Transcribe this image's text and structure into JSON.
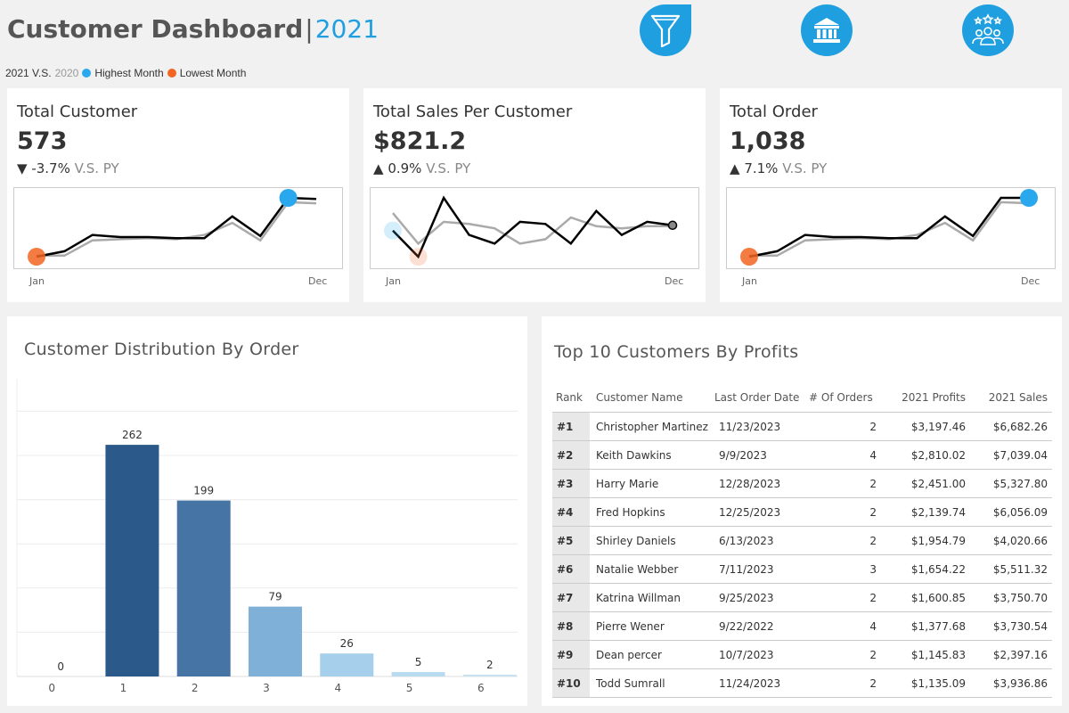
{
  "header": {
    "title": "Customer Dashboard",
    "separator": "|",
    "year": "2021"
  },
  "legend": {
    "current": "2021 V.S.",
    "previous": "2020",
    "highest_label": "Highest Month",
    "lowest_label": "Lowest Month"
  },
  "colors": {
    "accent": "#1f9fe0",
    "highest": "#29a8ee",
    "lowest": "#f26522",
    "line_current": "#000000",
    "line_previous": "#aaaaaa"
  },
  "nav": [
    {
      "icon": "filter-icon"
    },
    {
      "icon": "bank-icon"
    },
    {
      "icon": "customers-icon"
    }
  ],
  "kpis": [
    {
      "label": "Total Customer",
      "value": "573",
      "arrow": "▼",
      "delta": "-3.7%",
      "vs": "V.S. PY",
      "x_start": "Jan",
      "x_end": "Dec",
      "current": [
        43,
        48,
        63,
        61,
        61,
        60,
        60,
        80,
        62,
        97,
        96
      ],
      "previous": [
        44,
        44,
        58,
        59,
        60,
        59,
        63,
        74,
        58,
        93,
        92
      ],
      "highest_index": 9,
      "lowest_index": 0
    },
    {
      "label": "Total Sales Per Customer",
      "value": "$821.2",
      "arrow": "▲",
      "delta": "0.9%",
      "vs": "V.S. PY",
      "x_start": "Jan",
      "x_end": "Dec",
      "current": [
        830,
        770,
        905,
        820,
        800,
        850,
        845,
        800,
        875,
        820,
        850,
        842
      ],
      "previous": [
        870,
        800,
        850,
        845,
        835,
        800,
        810,
        860,
        840,
        835,
        840,
        840
      ],
      "highest_index": 0,
      "lowest_index": 1
    },
    {
      "label": "Total Order",
      "value": "1,038",
      "arrow": "▲",
      "delta": "7.1%",
      "vs": "V.S. PY",
      "x_start": "Jan",
      "x_end": "Dec",
      "current": [
        43,
        48,
        63,
        61,
        61,
        60,
        60,
        80,
        62,
        97,
        97
      ],
      "previous": [
        44,
        44,
        58,
        59,
        60,
        59,
        63,
        74,
        58,
        93,
        92
      ],
      "highest_index": 10,
      "lowest_index": 0
    }
  ],
  "distribution": {
    "title": "Customer Distribution By Order"
  },
  "chart_data": {
    "type": "bar",
    "title": "Customer Distribution By Order",
    "categories": [
      "0",
      "1",
      "2",
      "3",
      "4",
      "5",
      "6"
    ],
    "values": [
      0,
      262,
      199,
      79,
      26,
      5,
      2
    ],
    "colors": [
      "#2b5a8a",
      "#2b5a8a",
      "#4674a5",
      "#7fb1d8",
      "#a5cfea",
      "#b9dbf0",
      "#c6e2f3"
    ],
    "ylim": [
      0,
      300
    ],
    "grid": true
  },
  "top10": {
    "title": "Top 10 Customers By Profits",
    "headers": {
      "rank": "Rank",
      "name": "Customer Name",
      "date": "Last Order Date",
      "orders": "# Of Orders",
      "profits": "2021 Profits",
      "sales": "2021 Sales"
    },
    "rows": [
      {
        "rank": "#1",
        "name": "Christopher Martinez",
        "date": "11/23/2023",
        "orders": "2",
        "profits": "$3,197.46",
        "sales": "$6,682.26"
      },
      {
        "rank": "#2",
        "name": "Keith Dawkins",
        "date": "9/9/2023",
        "orders": "4",
        "profits": "$2,810.02",
        "sales": "$7,039.04"
      },
      {
        "rank": "#3",
        "name": "Harry Marie",
        "date": "12/28/2023",
        "orders": "2",
        "profits": "$2,451.00",
        "sales": "$5,327.80"
      },
      {
        "rank": "#4",
        "name": "Fred Hopkins",
        "date": "12/25/2023",
        "orders": "2",
        "profits": "$2,139.74",
        "sales": "$6,056.09"
      },
      {
        "rank": "#5",
        "name": "Shirley Daniels",
        "date": "6/13/2023",
        "orders": "2",
        "profits": "$1,954.79",
        "sales": "$4,020.66"
      },
      {
        "rank": "#6",
        "name": "Natalie Webber",
        "date": "7/11/2023",
        "orders": "3",
        "profits": "$1,654.22",
        "sales": "$5,511.32"
      },
      {
        "rank": "#7",
        "name": "Katrina Willman",
        "date": "9/25/2023",
        "orders": "2",
        "profits": "$1,600.85",
        "sales": "$3,750.70"
      },
      {
        "rank": "#8",
        "name": "Pierre Wener",
        "date": "9/22/2022",
        "orders": "4",
        "profits": "$1,377.68",
        "sales": "$3,730.54"
      },
      {
        "rank": "#9",
        "name": "Dean percer",
        "date": "10/7/2023",
        "orders": "2",
        "profits": "$1,145.83",
        "sales": "$2,397.16"
      },
      {
        "rank": "#10",
        "name": "Todd Sumrall",
        "date": "11/24/2023",
        "orders": "2",
        "profits": "$1,135.09",
        "sales": "$3,936.86"
      }
    ]
  }
}
